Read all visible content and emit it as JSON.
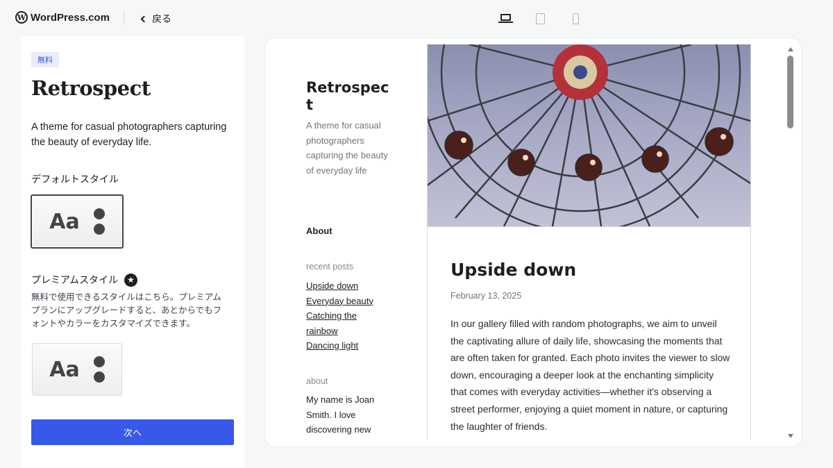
{
  "topbar": {
    "logo_text": "WordPress.com",
    "back_label": "戻る",
    "devices": [
      "laptop-icon",
      "tablet-icon",
      "phone-icon"
    ]
  },
  "sidebar": {
    "badge": "無料",
    "theme_name": "Retrospect",
    "theme_description": "A theme for casual photographers capturing the beauty of everyday life.",
    "default_style_label": "デフォルトスタイル",
    "style_sample": "Aa",
    "premium_style_label": "プレミアムスタイル",
    "premium_description": "無料で使用できるスタイルはこちら。プレミアムプランにアップグレードすると、あとからでもフォントやカラーをカスタマイズできます。",
    "next_button": "次へ"
  },
  "preview": {
    "site_title": "Retrospect",
    "site_tagline": "A theme for casual photographers capturing the beauty of everyday life",
    "nav_about": "About",
    "recent_posts_heading": "recent posts",
    "recent_posts": [
      "Upside down",
      "Everyday beauty",
      "Catching the rainbow",
      "Dancing light"
    ],
    "about_heading": "about",
    "about_text": "My name is Joan Smith. I love discovering new",
    "post": {
      "title": "Upside down",
      "date": "February 13, 2025",
      "body": "In our gallery filled with random photographs, we aim to unveil the captivating allure of daily life, showcasing the moments that are often taken for granted. Each photo invites the viewer to slow down, encouraging a deeper look at the enchanting simplicity that comes with everyday activities—whether it's observing a street performer, enjoying a quiet moment in nature, or capturing the laughter of friends."
    }
  },
  "colors": {
    "accent": "#3858e9",
    "badge_bg": "#e9ecfb"
  }
}
